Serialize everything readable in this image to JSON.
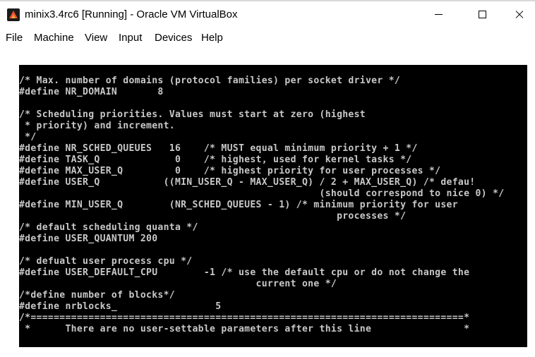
{
  "window": {
    "title": "minix3.4rc6 [Running] - Oracle VM VirtualBox",
    "icon": "virtualbox-icon",
    "controls": [
      "minimize-icon",
      "maximize-icon",
      "close-icon"
    ]
  },
  "menubar": {
    "items": [
      "File",
      "Machine",
      "View",
      "Input",
      "Devices",
      "Help"
    ]
  },
  "console": {
    "lines": [
      "/* Max. number of domains (protocol families) per socket driver */",
      "#define NR_DOMAIN       8",
      "",
      "/* Scheduling priorities. Values must start at zero (highest",
      " * priority) and increment.",
      " */",
      "#define NR_SCHED_QUEUES   16    /* MUST equal minimum priority + 1 */",
      "#define TASK_Q             0    /* highest, used for kernel tasks */",
      "#define MAX_USER_Q         0    /* highest priority for user processes */",
      "#define USER_Q           ((MIN_USER_Q - MAX_USER_Q) / 2 + MAX_USER_Q) /* defau!",
      "                                                    (should correspond to nice 0) */",
      "#define MIN_USER_Q        (NR_SCHED_QUEUES - 1) /* minimum priority for user",
      "                                                       processes */",
      "/* default scheduling quanta */",
      "#define USER_QUANTUM 200",
      "",
      "/* defualt user process cpu */",
      "#define USER_DEFAULT_CPU        -1 /* use the default cpu or do not change the",
      "                                         current one */",
      "/*define number of blocks*/",
      "#define nrblocks_                 5",
      "/*===========================================================================*",
      " *      There are no user-settable parameters after this line                *"
    ]
  }
}
